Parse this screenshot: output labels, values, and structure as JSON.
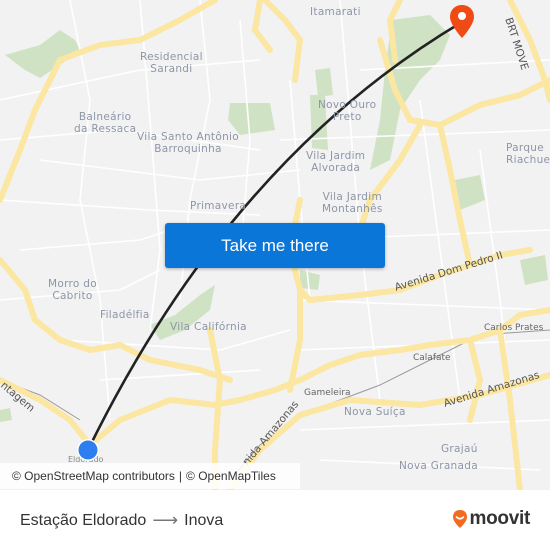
{
  "map": {
    "places": [
      {
        "id": "itamarati",
        "label": "Itamarati"
      },
      {
        "id": "residencial-sarandi",
        "label": "Residencial\nSarandi"
      },
      {
        "id": "balneario",
        "label": "Balneário\nda Ressaca"
      },
      {
        "id": "vila-santo-antonio",
        "label": "Vila Santo Antônio\nBarroquinha"
      },
      {
        "id": "novo-ouro-preto",
        "label": "Novo Ouro\nPreto"
      },
      {
        "id": "vila-jardim-alvorada",
        "label": "Vila Jardim\nAlvorada"
      },
      {
        "id": "parque-riachuelo",
        "label": "Parque\nRiachuelo"
      },
      {
        "id": "primavera",
        "label": "Primavera"
      },
      {
        "id": "vila-jardim-montanhes",
        "label": "Vila Jardim\nMontanhês"
      },
      {
        "id": "morro-do-cabrito",
        "label": "Morro do\nCabrito"
      },
      {
        "id": "filadelfia",
        "label": "Filadélfia"
      },
      {
        "id": "vila-california",
        "label": "Vila Califórnia"
      },
      {
        "id": "nova-suica",
        "label": "Nova Suíça"
      },
      {
        "id": "grajau",
        "label": "Grajaú"
      },
      {
        "id": "nova-granada",
        "label": "Nova Granada"
      }
    ],
    "streets": [
      {
        "id": "brt-move",
        "label": "BRT MOVE"
      },
      {
        "id": "av-dom-pedro",
        "label": "Avenida Dom Pedro II"
      },
      {
        "id": "av-amazonas-east",
        "label": "Avenida Amazonas"
      },
      {
        "id": "av-amazonas-west",
        "label": "nida Amazonas"
      },
      {
        "id": "contagem",
        "label": "ntagem"
      }
    ],
    "stations": [
      {
        "id": "carlos-prates",
        "label": "Carlos Prates"
      },
      {
        "id": "calafate",
        "label": "Calafate"
      },
      {
        "id": "gameleira",
        "label": "Gameleira"
      },
      {
        "id": "eldorado",
        "label": "Eldorado"
      }
    ],
    "origin_marker": {
      "icon": "origin-dot-icon",
      "color": "#2e7ef0"
    },
    "destination_marker": {
      "icon": "destination-pin-icon",
      "color": "#f04b16"
    },
    "route_line_color": "#222222",
    "cta_label": "Take me there",
    "attribution": {
      "osm": "© OpenStreetMap contributors",
      "separator": "|",
      "omt": "© OpenMapTiles"
    }
  },
  "footer": {
    "origin": "Estação Eldorado",
    "arrow": "⟶",
    "destination": "Inova",
    "logo_text": "moovit",
    "logo_color": "#f26b21"
  }
}
